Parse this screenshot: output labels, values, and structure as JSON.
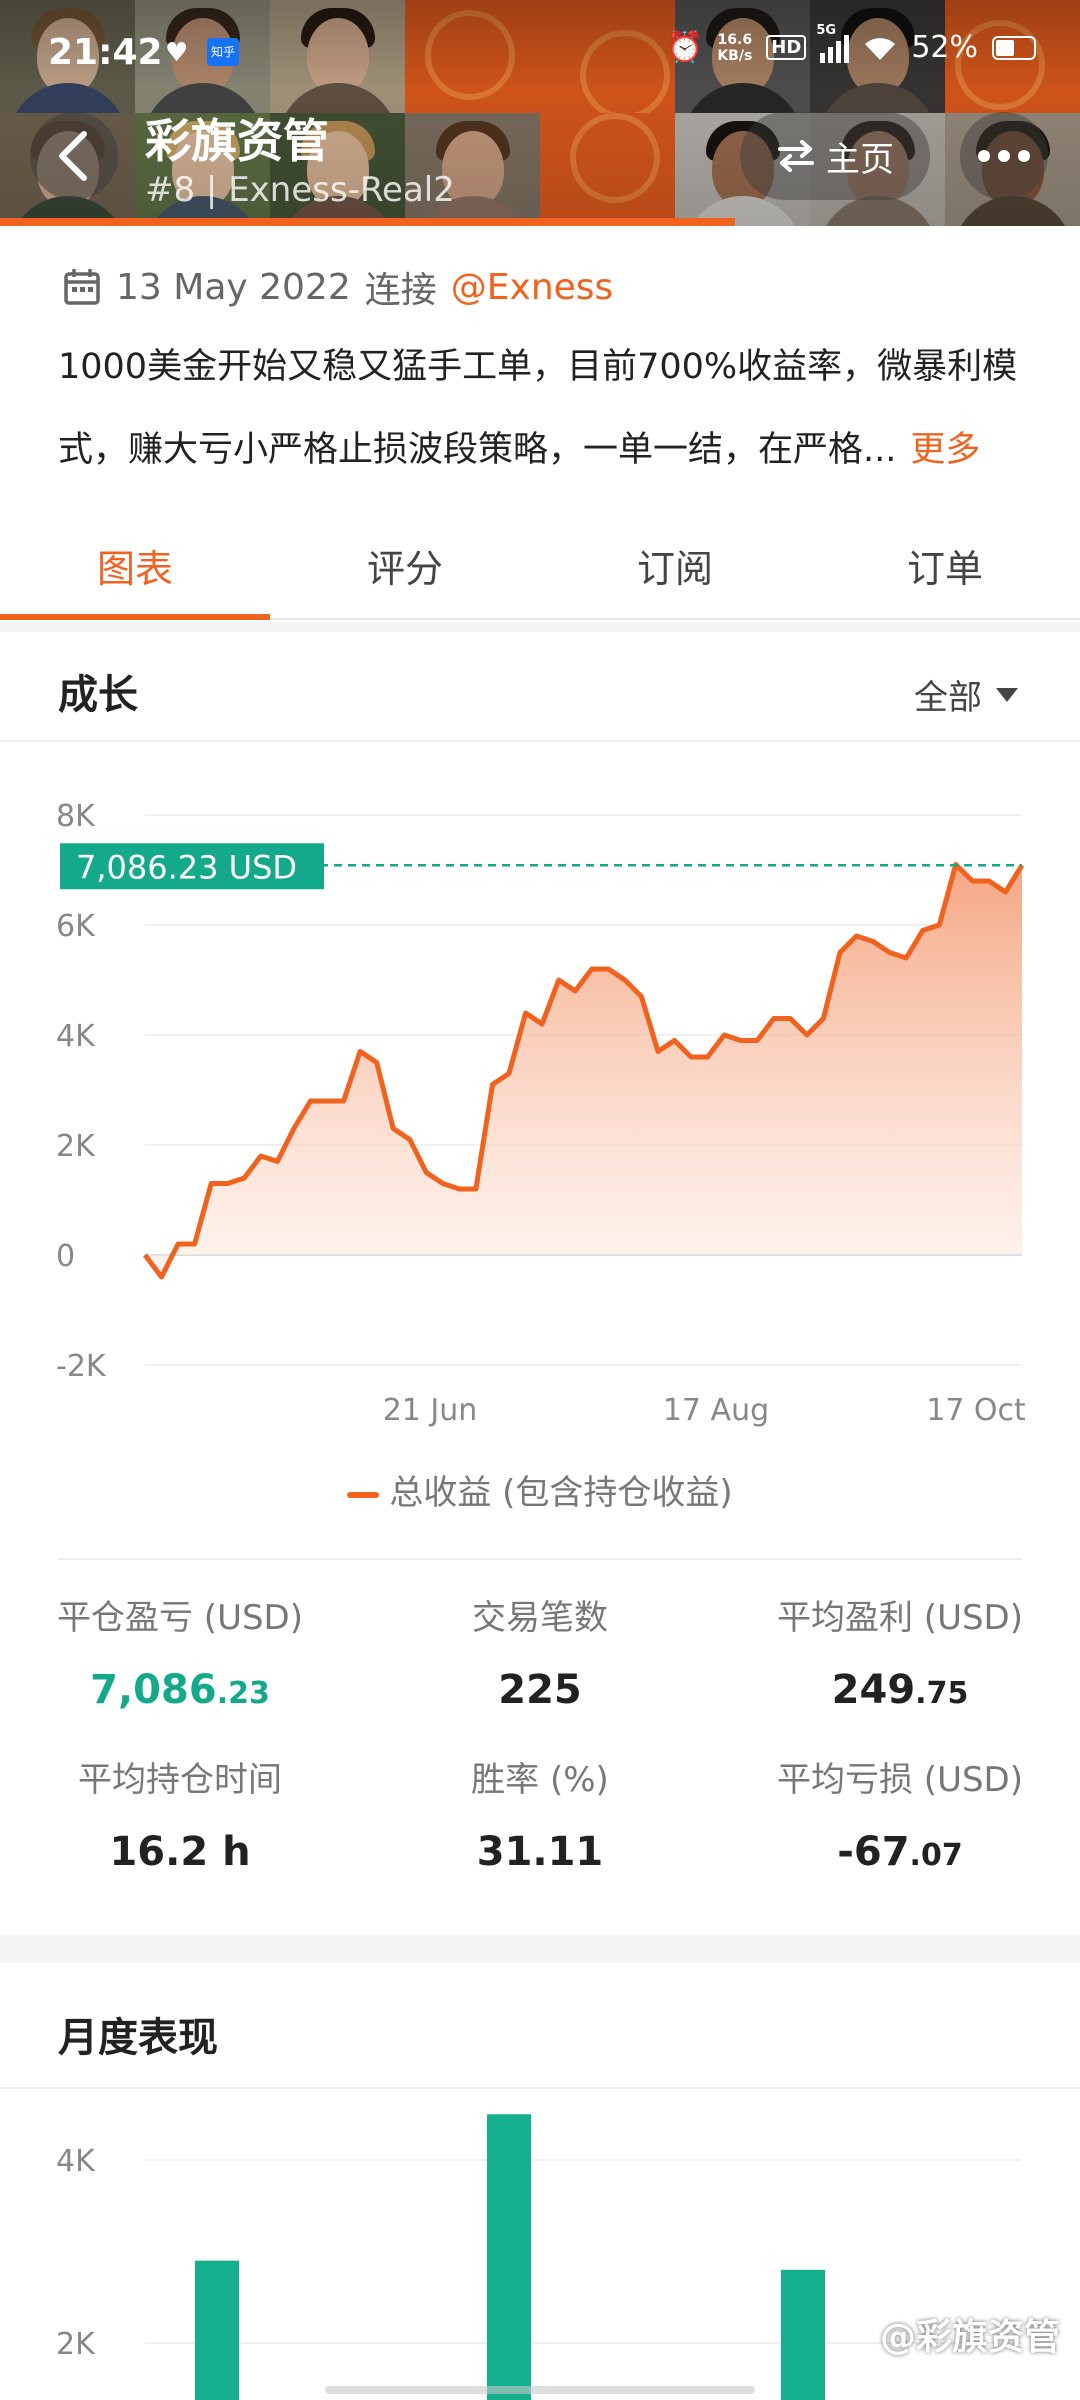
{
  "status_bar": {
    "time": "21:42",
    "zhihu": "知乎",
    "net_speed": "16.6",
    "net_unit": "KB/s",
    "hd": "HD",
    "signal": "5G",
    "battery": "52%"
  },
  "header": {
    "title": "彩旗资管",
    "subtitle": "#8 | Exness-Real2",
    "home_label": "主页"
  },
  "info": {
    "date": "13 May 2022",
    "connect_word": "连接",
    "handle": "@Exness",
    "description": "1000美金开始又稳又猛手工单，目前700%收益率，微暴利模式，赚大亏小严格止损波段策略，一单一结，在严格...",
    "more_label": "更多"
  },
  "tabs": [
    {
      "label": "图表"
    },
    {
      "label": "评分"
    },
    {
      "label": "订阅"
    },
    {
      "label": "订单"
    }
  ],
  "growth": {
    "title": "成长",
    "filter_label": "全部"
  },
  "chart_data": {
    "type": "area",
    "y_ticks": [
      "8K",
      "6K",
      "4K",
      "2K",
      "0",
      "-2K"
    ],
    "x_ticks": [
      "21 Jun",
      "17 Aug",
      "17 Oct"
    ],
    "ylim": [
      -2000,
      8000
    ],
    "current_value_label": "7,086.23 USD",
    "current_value": 7086.23,
    "legend": "总收益 (包含持仓收益)",
    "series": [
      {
        "name": "总收益 (包含持仓收益)",
        "values": [
          0,
          -400,
          200,
          200,
          1300,
          1300,
          1400,
          1800,
          1700,
          2300,
          2800,
          2800,
          2800,
          3700,
          3500,
          2300,
          2100,
          1500,
          1300,
          1200,
          1200,
          3100,
          3300,
          4400,
          4200,
          5000,
          4800,
          5200,
          5200,
          5000,
          4700,
          3700,
          3900,
          3600,
          3600,
          4000,
          3900,
          3900,
          4300,
          4300,
          4000,
          4300,
          5500,
          5800,
          5700,
          5500,
          5400,
          5900,
          6000,
          7100,
          6800,
          6800,
          6600,
          7086
        ]
      }
    ]
  },
  "stats": [
    {
      "label": "平仓盈亏 (USD)",
      "value": "7,086",
      "dec": ".23",
      "color": "green"
    },
    {
      "label": "交易笔数",
      "value": "225",
      "dec": "",
      "color": "normal"
    },
    {
      "label": "平均盈利 (USD)",
      "value": "249",
      "dec": ".75",
      "color": "normal"
    },
    {
      "label": "平均持仓时间",
      "value": "16.2 h",
      "dec": "",
      "color": "normal"
    },
    {
      "label": "胜率 (%)",
      "value": "31.11",
      "dec": "",
      "color": "normal"
    },
    {
      "label": "平均亏损 (USD)",
      "value": "-67",
      "dec": ".07",
      "color": "normal"
    }
  ],
  "monthly": {
    "title": "月度表现",
    "y_ticks": [
      "4K",
      "2K"
    ],
    "bar_values": [
      2900,
      4500,
      2800
    ],
    "bar_color": "#14b08e"
  },
  "watermark": "@彩旗资管"
}
